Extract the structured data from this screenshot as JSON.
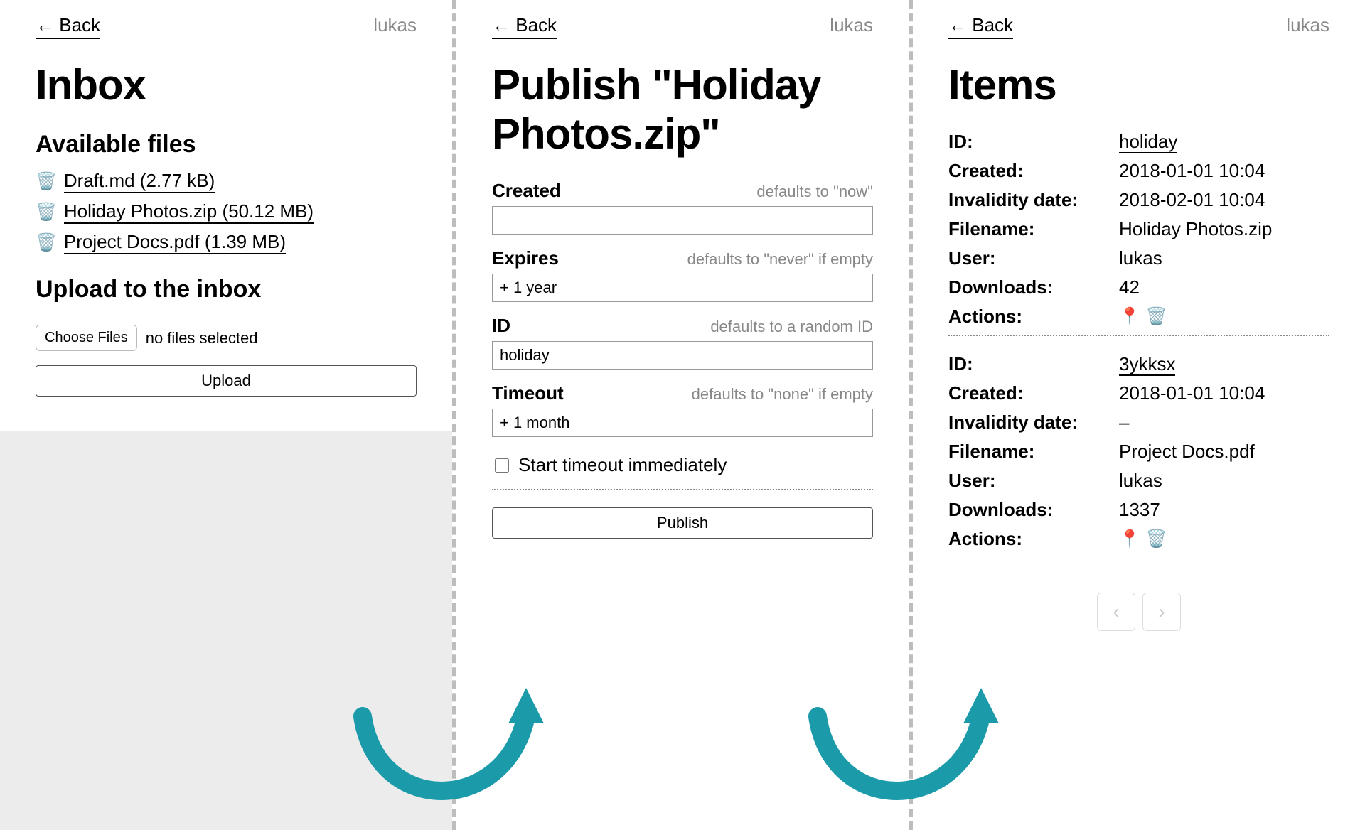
{
  "common": {
    "back": "← Back",
    "user": "lukas"
  },
  "panel1": {
    "title": "Inbox",
    "available_heading": "Available files",
    "files": [
      {
        "name": "Draft.md",
        "size": "2.77 kB"
      },
      {
        "name": "Holiday Photos.zip",
        "size": "50.12 MB"
      },
      {
        "name": "Project Docs.pdf",
        "size": "1.39 MB"
      }
    ],
    "upload_heading": "Upload to the inbox",
    "choose_label": "Choose Files",
    "no_files": "no files selected",
    "upload_btn": "Upload"
  },
  "panel2": {
    "title": "Publish \"Holiday Photos.zip\"",
    "fields": {
      "created": {
        "label": "Created",
        "hint": "defaults to \"now\"",
        "value": ""
      },
      "expires": {
        "label": "Expires",
        "hint": "defaults to \"never\" if empty",
        "value": "+ 1 year"
      },
      "id": {
        "label": "ID",
        "hint": "defaults to a random ID",
        "value": "holiday"
      },
      "timeout": {
        "label": "Timeout",
        "hint": "defaults to \"none\" if empty",
        "value": "+ 1 month"
      }
    },
    "checkbox_label": "Start timeout immediately",
    "publish_btn": "Publish"
  },
  "panel3": {
    "title": "Items",
    "labels": {
      "id": "ID:",
      "created": "Created:",
      "invalid": "Invalidity date:",
      "filename": "Filename:",
      "user": "User:",
      "downloads": "Downloads:",
      "actions": "Actions:"
    },
    "items": [
      {
        "id": "holiday",
        "created": "2018-01-01 10:04",
        "invalid": "2018-02-01 10:04",
        "filename": "Holiday Photos.zip",
        "user": "lukas",
        "downloads": "42"
      },
      {
        "id": "3ykksx",
        "created": "2018-01-01 10:04",
        "invalid": "–",
        "filename": "Project Docs.pdf",
        "user": "lukas",
        "downloads": "1337"
      }
    ],
    "pager_prev": "‹",
    "pager_next": "›"
  }
}
